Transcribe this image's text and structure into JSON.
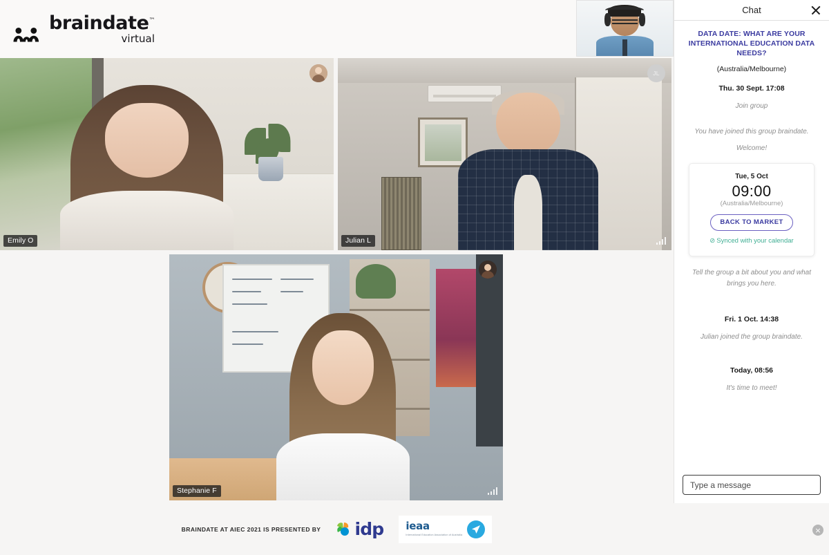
{
  "header": {
    "brand_word": "braindate",
    "brand_tm": "™",
    "brand_sub": "virtual",
    "logo_icon": "braindate-people-icon"
  },
  "stage": {
    "tiles": [
      {
        "name": "Emily O",
        "avatar_type": "photo",
        "avatar_initials": "",
        "signal": false
      },
      {
        "name": "Julian L",
        "avatar_type": "initials",
        "avatar_initials": "JL",
        "signal": true
      },
      {
        "name": "Stephanie F",
        "avatar_type": "photo",
        "avatar_initials": "",
        "signal": true
      }
    ],
    "selfview_label": "self-view"
  },
  "chat": {
    "title": "Chat",
    "close_icon": "close-icon",
    "topic_title": "DATA DATE: WHAT ARE YOUR INTERNATIONAL EDUCATION DATA NEEDS?",
    "timezone": "(Australia/Melbourne)",
    "entries": [
      {
        "kind": "time",
        "text": "Thu. 30 Sept. 17:08"
      },
      {
        "kind": "note",
        "text": "Join group"
      },
      {
        "kind": "note",
        "text": "You have joined this group braindate."
      },
      {
        "kind": "note",
        "text": "Welcome!"
      }
    ],
    "entries_after_card": [
      {
        "kind": "note",
        "text": "Tell the group a bit about you and what brings you here."
      },
      {
        "kind": "time",
        "text": "Fri. 1 Oct. 14:38"
      },
      {
        "kind": "note",
        "text": "Julian joined the group braindate."
      },
      {
        "kind": "time",
        "text": "Today, 08:56"
      },
      {
        "kind": "note",
        "text": "It's time to meet!"
      }
    ],
    "meeting_card": {
      "date": "Tue, 5 Oct",
      "time": "09:00",
      "timezone": "(Australia/Melbourne)",
      "button_label": "BACK TO MARKET",
      "sync_icon": "check-circle-icon",
      "sync_text": "Synced with your calendar"
    },
    "input_placeholder": "Type a message",
    "input_value": ""
  },
  "footer": {
    "presented_by": "BRAINDATE AT AIEC 2021 IS PRESENTED BY",
    "sponsors": [
      {
        "name": "idp",
        "icon": "idp-pinwheel-icon"
      },
      {
        "name": "ieaa",
        "tagline": "International Education Association of Australia",
        "icon": "ieaa-plane-icon"
      }
    ]
  },
  "overlay": {
    "close_icon": "close-circle-icon",
    "close_glyph": "×"
  },
  "colors": {
    "accent_blue": "#3b3ba0",
    "button_border": "#6a5fc1",
    "sync_green": "#3fae93",
    "stage_bg": "#f6f5f4",
    "idp_blue": "#2f3a8f",
    "ieaa_blue": "#1e5b8f"
  }
}
